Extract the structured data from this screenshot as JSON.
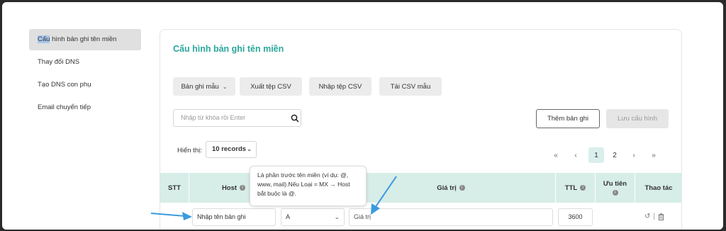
{
  "sidebar": {
    "items": [
      {
        "label_hl": "Cấu",
        "label_rest": " hình bản ghi tên miền",
        "active": true
      },
      {
        "label": "Thay đổi DNS"
      },
      {
        "label": "Tạo DNS con phụ"
      },
      {
        "label": "Email chuyển tiếp"
      }
    ]
  },
  "panel": {
    "title": "Cấu hình bản ghi tên miền",
    "toolbar": {
      "template_label": "Bản ghi mẫu",
      "export_label": "Xuất tệp CSV",
      "import_label": "Nhập tệp CSV",
      "download_label": "Tải CSV mẫu"
    },
    "search": {
      "placeholder": "Nhập từ khóa rồi Enter"
    },
    "add_label": "Thêm bản ghi",
    "save_label": "Lưu cấu hình",
    "show_label": "Hiển thị:",
    "page_size": "10 records",
    "pagination": {
      "first": "«",
      "prev": "‹",
      "pages": [
        "1",
        "2"
      ],
      "next": "›",
      "last": "»",
      "current": "1"
    },
    "table": {
      "headers": {
        "stt": "STT",
        "host": "Host",
        "value": "Giá trị",
        "ttl": "TTL",
        "priority": "Ưu tiên",
        "actions": "Thao tác"
      },
      "tooltip": "Là phần trước tên miền (ví dụ: @, www, mail).Nếu Loại = MX → Host bắt buộc là @.",
      "row": {
        "host_placeholder": "Nhập tên bản ghi",
        "type": "A",
        "value_placeholder": "Giá trị",
        "ttl": "3600"
      }
    }
  },
  "colors": {
    "accent": "#2aa79b",
    "header_bg": "#d7ede8",
    "arrow": "#3b9be0"
  }
}
